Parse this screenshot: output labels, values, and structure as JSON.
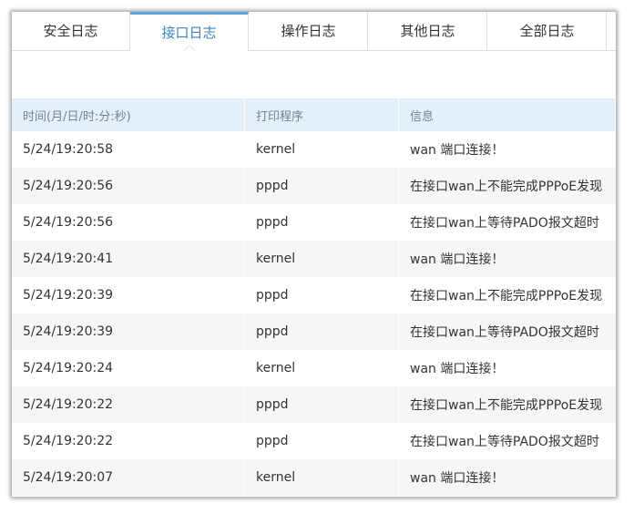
{
  "tabs": [
    {
      "label": "安全日志",
      "active": false
    },
    {
      "label": "接口日志",
      "active": true
    },
    {
      "label": "操作日志",
      "active": false
    },
    {
      "label": "其他日志",
      "active": false
    },
    {
      "label": "全部日志",
      "active": false
    }
  ],
  "table": {
    "headers": [
      "时间(月/日/时:分:秒)",
      "打印程序",
      "信息"
    ],
    "rows": [
      {
        "time": "5/24/19:20:58",
        "program": "kernel",
        "info": "wan 端口连接！"
      },
      {
        "time": "5/24/19:20:56",
        "program": "pppd",
        "info": "在接口wan上不能完成PPPoE发现"
      },
      {
        "time": "5/24/19:20:56",
        "program": "pppd",
        "info": "在接口wan上等待PADO报文超时"
      },
      {
        "time": "5/24/19:20:41",
        "program": "kernel",
        "info": "wan 端口连接！"
      },
      {
        "time": "5/24/19:20:39",
        "program": "pppd",
        "info": "在接口wan上不能完成PPPoE发现"
      },
      {
        "time": "5/24/19:20:39",
        "program": "pppd",
        "info": "在接口wan上等待PADO报文超时"
      },
      {
        "time": "5/24/19:20:24",
        "program": "kernel",
        "info": "wan 端口连接！"
      },
      {
        "time": "5/24/19:20:22",
        "program": "pppd",
        "info": "在接口wan上不能完成PPPoE发现"
      },
      {
        "time": "5/24/19:20:22",
        "program": "pppd",
        "info": "在接口wan上等待PADO报文超时"
      },
      {
        "time": "5/24/19:20:07",
        "program": "kernel",
        "info": "wan 端口连接！"
      }
    ]
  },
  "colors": {
    "accent": "#3a86c8",
    "active_tab_border": "#5aa5e0",
    "header_bg": "#e3eff9",
    "row_alt_bg": "#f6f6f6"
  }
}
